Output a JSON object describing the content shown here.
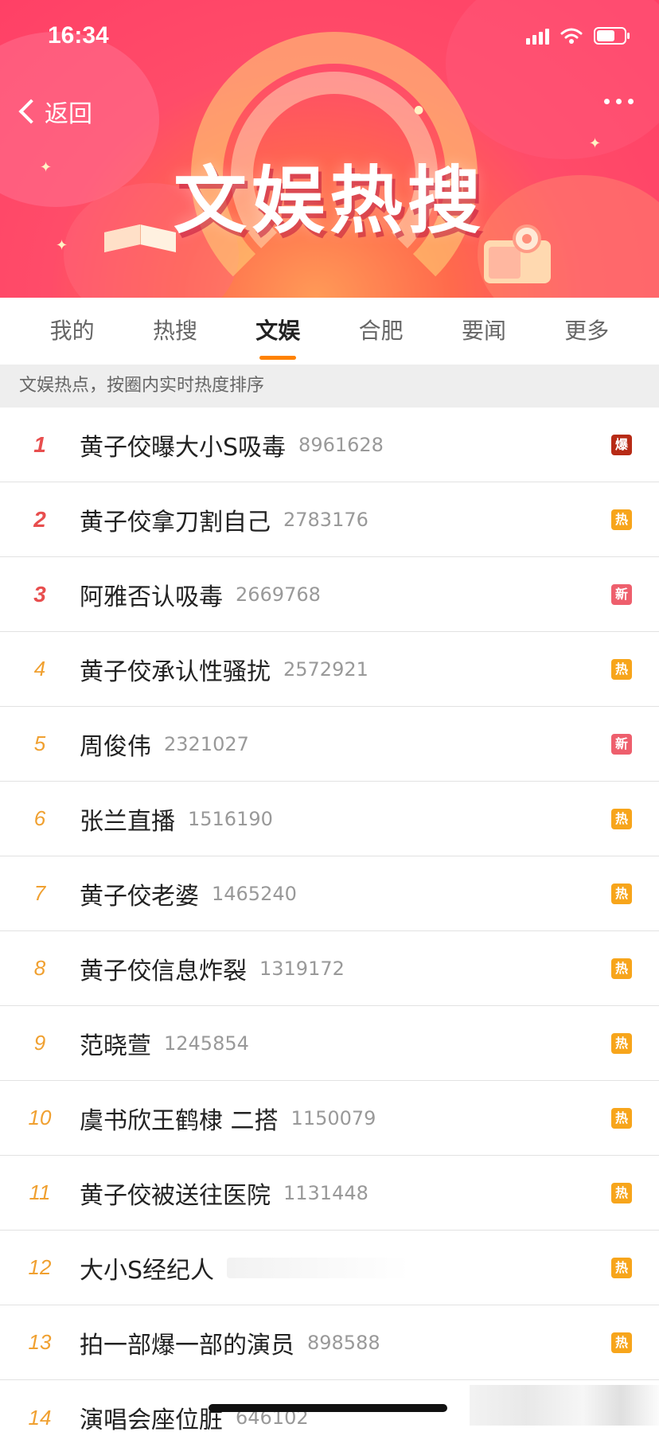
{
  "status_bar": {
    "time": "16:34"
  },
  "header": {
    "back_label": "返回",
    "title": "文娱热搜"
  },
  "tabs": [
    {
      "label": "我的"
    },
    {
      "label": "热搜"
    },
    {
      "label": "文娱",
      "active": true
    },
    {
      "label": "合肥"
    },
    {
      "label": "要闻"
    },
    {
      "label": "更多"
    }
  ],
  "subheader": "文娱热点，按圈内实时热度排序",
  "list": [
    {
      "rank": "1",
      "topic": "黄子佼曝大小S吸毒",
      "count": "8961628",
      "badge": "爆"
    },
    {
      "rank": "2",
      "topic": "黄子佼拿刀割自己",
      "count": "2783176",
      "badge": "热"
    },
    {
      "rank": "3",
      "topic": "阿雅否认吸毒",
      "count": "2669768",
      "badge": "新"
    },
    {
      "rank": "4",
      "topic": "黄子佼承认性骚扰",
      "count": "2572921",
      "badge": "热"
    },
    {
      "rank": "5",
      "topic": "周俊伟",
      "count": "2321027",
      "badge": "新"
    },
    {
      "rank": "6",
      "topic": "张兰直播",
      "count": "1516190",
      "badge": "热"
    },
    {
      "rank": "7",
      "topic": "黄子佼老婆",
      "count": "1465240",
      "badge": "热"
    },
    {
      "rank": "8",
      "topic": "黄子佼信息炸裂",
      "count": "1319172",
      "badge": "热"
    },
    {
      "rank": "9",
      "topic": "范晓萱",
      "count": "1245854",
      "badge": "热"
    },
    {
      "rank": "10",
      "topic": "虞书欣王鹤棣 二搭",
      "count": "1150079",
      "badge": "热"
    },
    {
      "rank": "11",
      "topic": "黄子佼被送往医院",
      "count": "1131448",
      "badge": "热"
    },
    {
      "rank": "12",
      "topic": "大小S经纪人",
      "count": "",
      "badge": "热"
    },
    {
      "rank": "13",
      "topic": "拍一部爆一部的演员",
      "count": "898588",
      "badge": "热"
    },
    {
      "rank": "14",
      "topic": "演唱会座位脏",
      "count": "646102",
      "badge": ""
    }
  ],
  "colors": {
    "accent": "#ff8200",
    "rank_top": "#e84e4e",
    "rank_other": "#f0a030",
    "badge_bao": "#b72b16",
    "badge_re": "#f7a51b",
    "badge_xin": "#ee5f6d"
  },
  "icons": {
    "back": "chevron-left-icon",
    "more": "more-dots-icon",
    "signal": "signal-icon",
    "wifi": "wifi-icon",
    "battery": "battery-icon"
  }
}
